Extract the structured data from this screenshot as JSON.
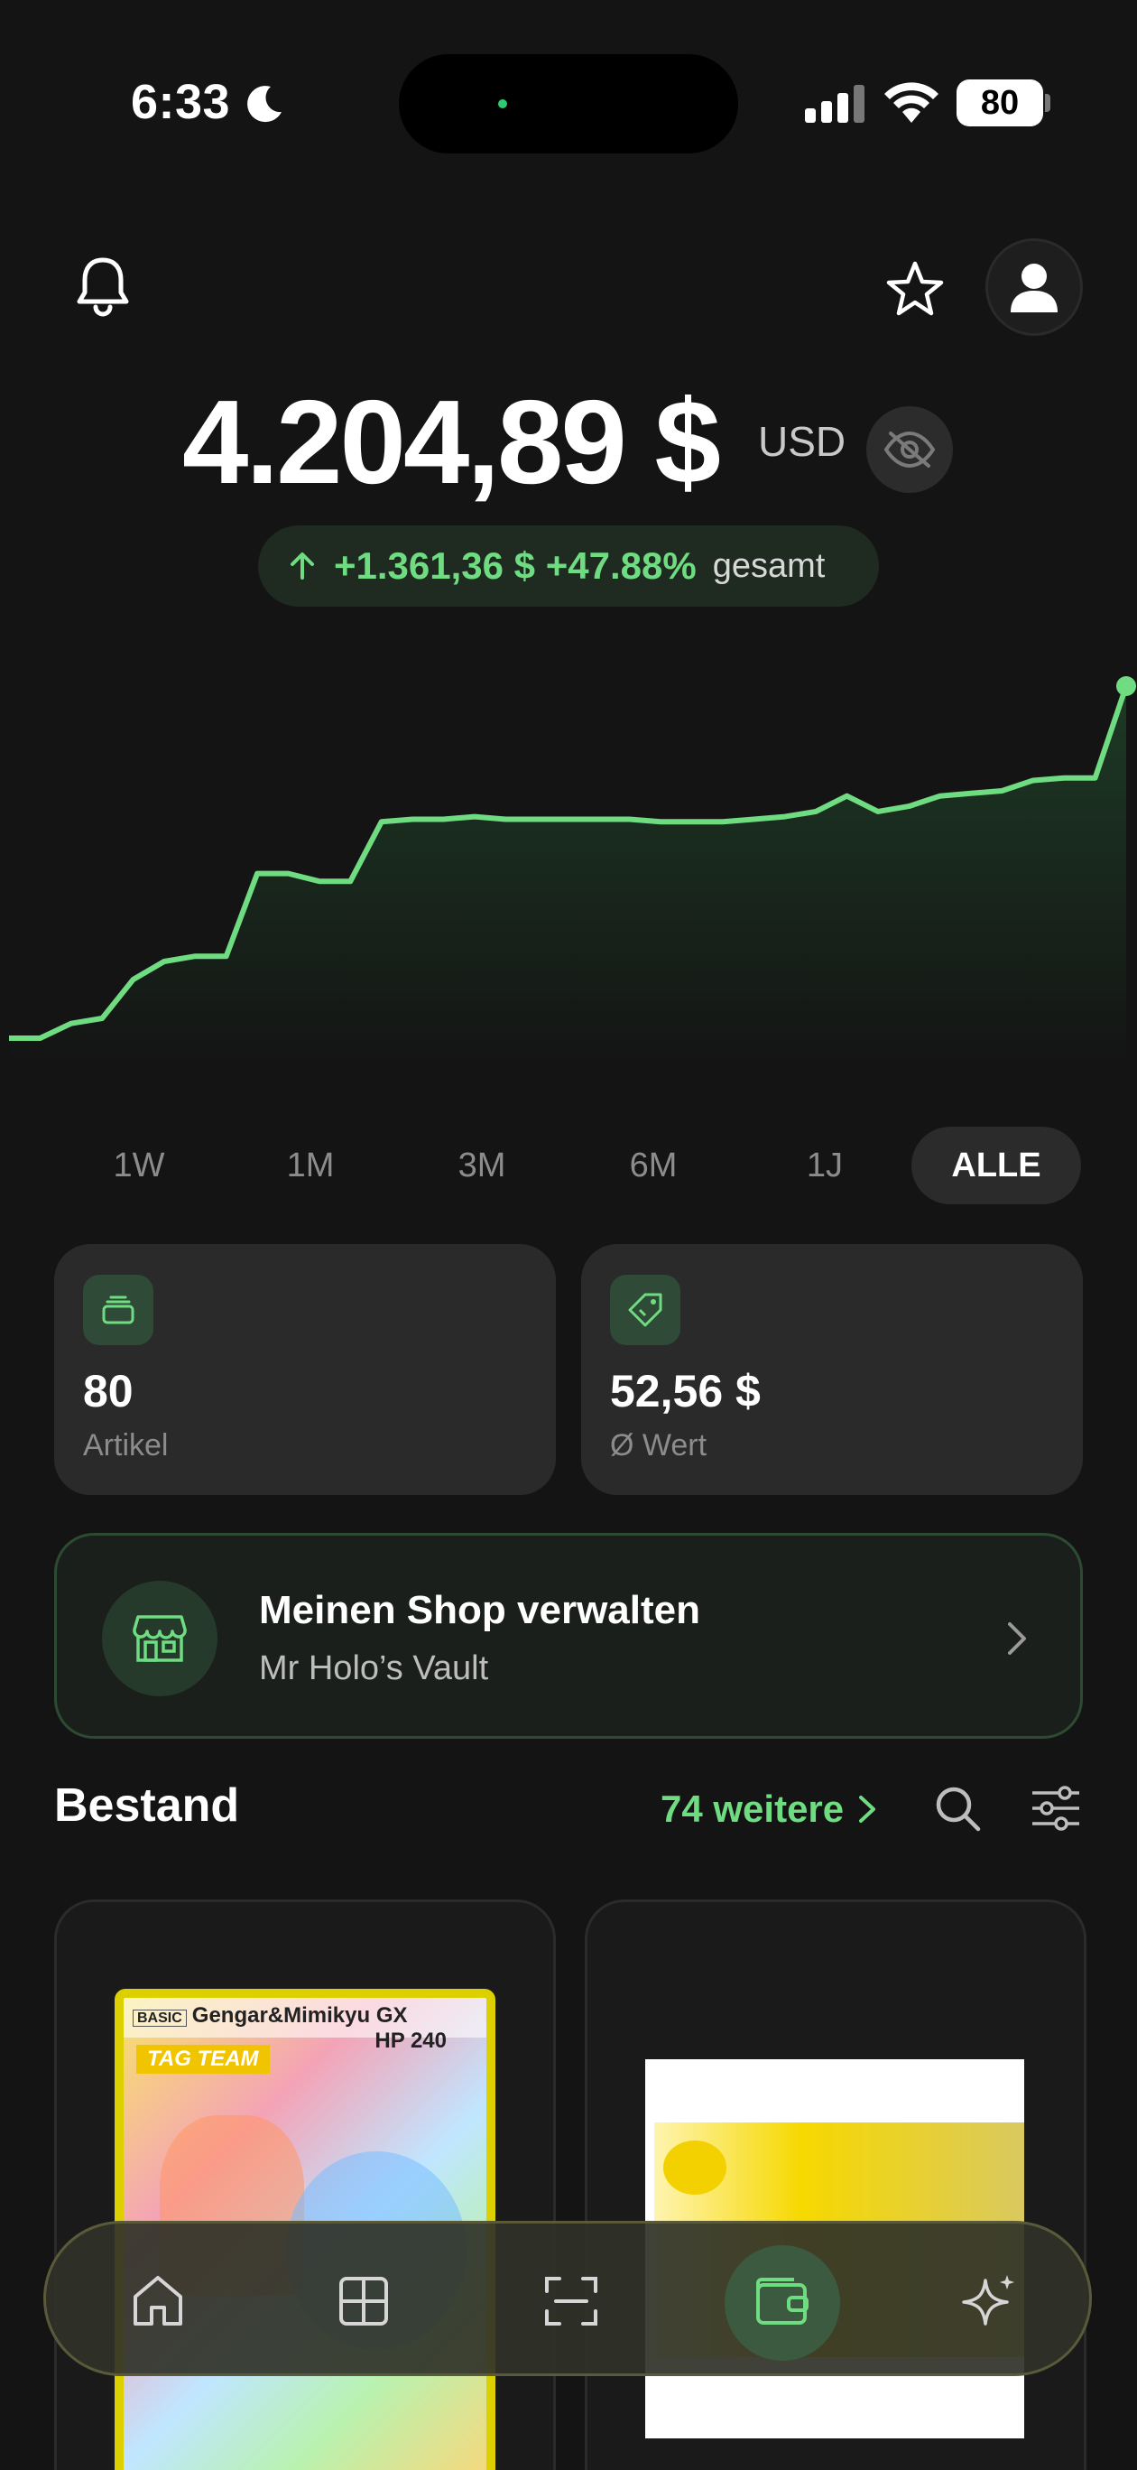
{
  "status": {
    "time": "6:33",
    "battery": "80"
  },
  "balance": {
    "amount": "4.204,89 $",
    "currency": "USD"
  },
  "change": {
    "value": "+1.361,36 $ +47.88%",
    "label": "gesamt"
  },
  "chart_data": {
    "type": "area",
    "title": "",
    "xlabel": "",
    "ylabel": "",
    "series": [
      {
        "values": [
          2843,
          2843,
          2900,
          2920,
          3070,
          3140,
          3160,
          3160,
          3480,
          3480,
          3450,
          3450,
          3680,
          3690,
          3690,
          3700,
          3690,
          3690,
          3690,
          3690,
          3690,
          3680,
          3680,
          3680,
          3690,
          3700,
          3720,
          3780,
          3720,
          3740,
          3780,
          3790,
          3800,
          3840,
          3850,
          3850,
          4205
        ]
      }
    ],
    "grid": false,
    "colors": {
      "line": "#6fdc82",
      "fill_top": "#1d3a25"
    }
  },
  "ranges": [
    "1W",
    "1M",
    "3M",
    "6M",
    "1J",
    "ALLE"
  ],
  "active_range": "ALLE",
  "stats": [
    {
      "icon": "stack-icon",
      "value": "80",
      "label": "Artikel"
    },
    {
      "icon": "tag-icon",
      "value": "52,56 $",
      "label": "Ø Wert"
    }
  ],
  "shop": {
    "title": "Meinen Shop verwalten",
    "subtitle": "Mr Holo’s Vault"
  },
  "inventory": {
    "title": "Bestand",
    "more": "74 weitere"
  },
  "products": [
    {
      "card_name": "Gengar&Mimikyu GX",
      "hp": "HP 240",
      "tag": "TAG TEAM",
      "basic": "BASIC"
    },
    {
      "name": ""
    }
  ],
  "nav": [
    "home-icon",
    "grid-icon",
    "scan-icon",
    "wallet-icon",
    "sparkle-icon"
  ],
  "colors": {
    "accent": "#6fdc82",
    "bg": "#141414",
    "card": "#2a2a2a"
  }
}
